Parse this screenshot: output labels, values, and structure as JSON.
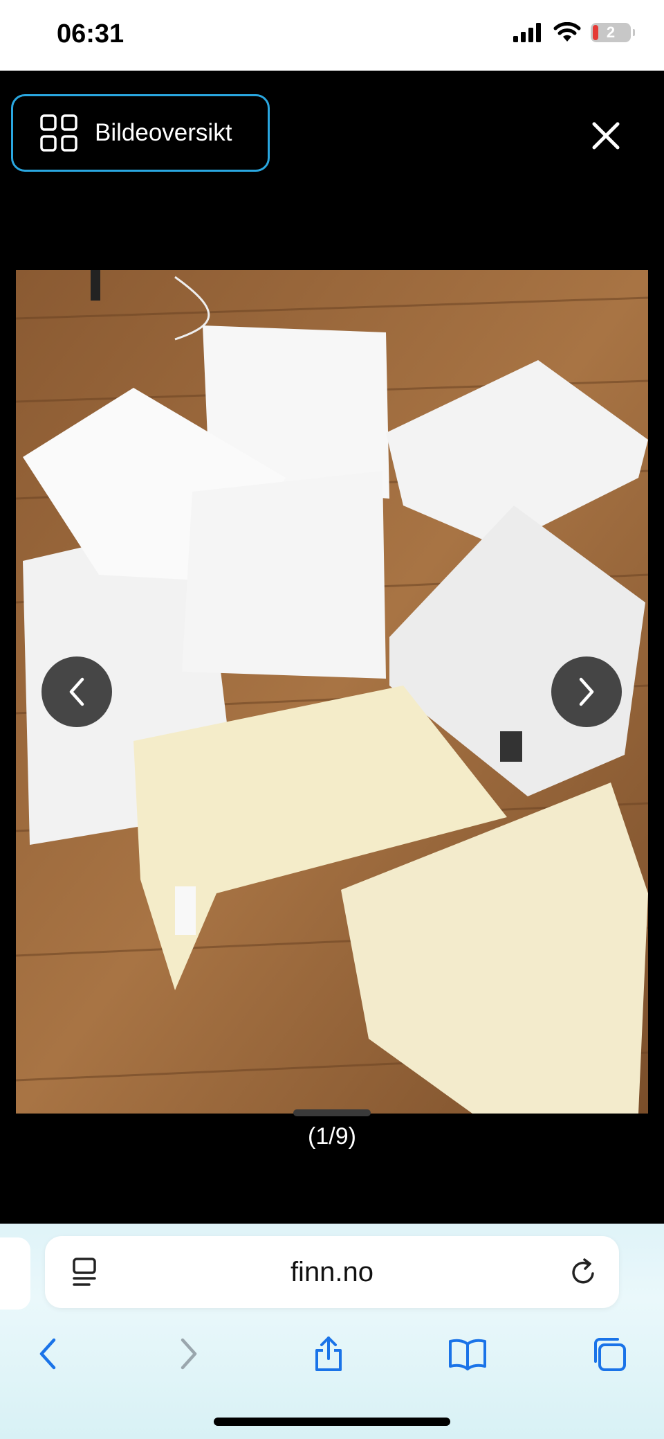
{
  "status_bar": {
    "time": "06:31",
    "battery": "2",
    "icons": [
      "signal-icon",
      "wifi-icon",
      "battery-icon"
    ]
  },
  "viewer": {
    "overview_label": "Bildeoversikt",
    "counter": "(1/9)",
    "accent": "#2aa7e0",
    "icons": [
      "grid-icon",
      "close-icon",
      "chevron-left-icon",
      "chevron-right-icon"
    ]
  },
  "browser": {
    "url": "finn.no",
    "toolbar_icons": [
      "back-icon",
      "forward-icon",
      "share-icon",
      "bookmarks-icon",
      "tabs-icon"
    ],
    "accent": "#1a73e8"
  }
}
